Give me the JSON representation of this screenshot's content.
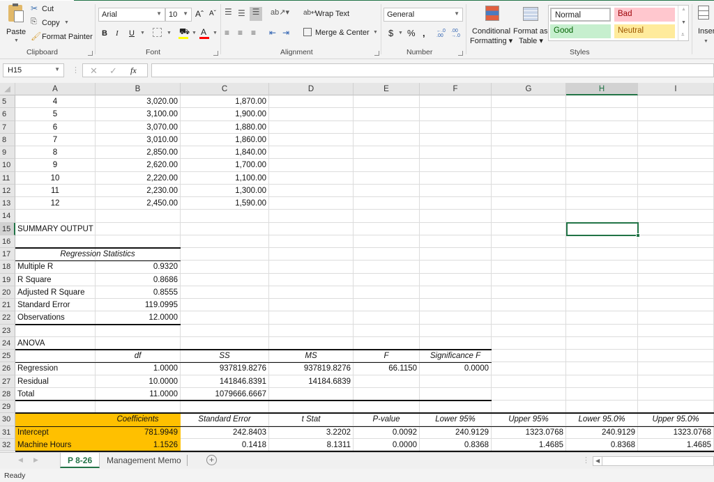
{
  "ribbon": {
    "clipboard": {
      "paste": "Paste",
      "cut": "Cut",
      "copy": "Copy",
      "format_painter": "Format Painter",
      "label": "Clipboard"
    },
    "font": {
      "name": "Arial",
      "size": "10",
      "bold": "B",
      "italic": "I",
      "underline": "U",
      "grow": "Aˆ",
      "shrink": "Aˇ",
      "label": "Font",
      "fill_color": "#ffff00",
      "font_color": "#ff0000"
    },
    "alignment": {
      "wrap_text": "Wrap Text",
      "merge_center": "Merge & Center",
      "label": "Alignment"
    },
    "number": {
      "format": "General",
      "currency": "$",
      "percent": "%",
      "comma": ",",
      "inc_decimal": "←.0 .00",
      "dec_decimal": ".00 →.0",
      "label": "Number"
    },
    "styles": {
      "conditional_formatting_1": "Conditional",
      "conditional_formatting_2": "Formatting",
      "format_as_table_1": "Format as",
      "format_as_table_2": "Table",
      "normal": "Normal",
      "bad": "Bad",
      "good": "Good",
      "neutral": "Neutral",
      "label": "Styles",
      "bad_bg": "#ffc7ce",
      "bad_fg": "#9c0006",
      "good_bg": "#c6efce",
      "good_fg": "#006100",
      "neutral_bg": "#ffeb9c",
      "neutral_fg": "#9c5700"
    },
    "cells": {
      "insert": "Insert"
    }
  },
  "formula_bar": {
    "name_box": "H15",
    "fx": "fx",
    "formula": ""
  },
  "columns": [
    "A",
    "B",
    "C",
    "D",
    "E",
    "F",
    "G",
    "H",
    "I"
  ],
  "selected_column": "H",
  "selected_row": "15",
  "rows": [
    "5",
    "6",
    "7",
    "8",
    "9",
    "10",
    "11",
    "12",
    "13",
    "14",
    "15",
    "16",
    "17",
    "18",
    "19",
    "20",
    "21",
    "22",
    "23",
    "24",
    "25",
    "26",
    "27",
    "28",
    "29",
    "30",
    "31",
    "32"
  ],
  "data_table": [
    {
      "month": "4",
      "cost": "3,020.00",
      "hours": "1,870.00"
    },
    {
      "month": "5",
      "cost": "3,100.00",
      "hours": "1,900.00"
    },
    {
      "month": "6",
      "cost": "3,070.00",
      "hours": "1,880.00"
    },
    {
      "month": "7",
      "cost": "3,010.00",
      "hours": "1,860.00"
    },
    {
      "month": "8",
      "cost": "2,850.00",
      "hours": "1,840.00"
    },
    {
      "month": "9",
      "cost": "2,620.00",
      "hours": "1,700.00"
    },
    {
      "month": "10",
      "cost": "2,220.00",
      "hours": "1,100.00"
    },
    {
      "month": "11",
      "cost": "2,230.00",
      "hours": "1,300.00"
    },
    {
      "month": "12",
      "cost": "2,450.00",
      "hours": "1,590.00"
    }
  ],
  "summary": {
    "title": "SUMMARY OUTPUT",
    "regression_statistics": {
      "header": "Regression Statistics",
      "rows": [
        {
          "label": "Multiple R",
          "value": "0.9320"
        },
        {
          "label": "R Square",
          "value": "0.8686"
        },
        {
          "label": "Adjusted R Square",
          "value": "0.8555"
        },
        {
          "label": "Standard Error",
          "value": "119.0995"
        },
        {
          "label": "Observations",
          "value": "12.0000"
        }
      ]
    },
    "anova": {
      "title": "ANOVA",
      "headers": [
        "df",
        "SS",
        "MS",
        "F",
        "Significance F"
      ],
      "rows": [
        {
          "label": "Regression",
          "df": "1.0000",
          "ss": "937819.8276",
          "ms": "937819.8276",
          "f": "66.1150",
          "sig": "0.0000"
        },
        {
          "label": "Residual",
          "df": "10.0000",
          "ss": "141846.8391",
          "ms": "14184.6839",
          "f": "",
          "sig": ""
        },
        {
          "label": "Total",
          "df": "11.0000",
          "ss": "1079666.6667",
          "ms": "",
          "f": "",
          "sig": ""
        }
      ]
    },
    "coefficients": {
      "headers": [
        "Coefficients",
        "Standard Error",
        "t Stat",
        "P-value",
        "Lower 95%",
        "Upper 95%",
        "Lower 95.0%",
        "Upper 95.0%"
      ],
      "rows": [
        {
          "label": "Intercept",
          "values": [
            "781.9949",
            "242.8403",
            "3.2202",
            "0.0092",
            "240.9129",
            "1323.0768",
            "240.9129",
            "1323.0768"
          ]
        },
        {
          "label": "Machine Hours",
          "values": [
            "1.1526",
            "0.1418",
            "8.1311",
            "0.0000",
            "0.8368",
            "1.4685",
            "0.8368",
            "1.4685"
          ]
        }
      ],
      "highlight_color": "#ffc000"
    }
  },
  "sheet_tabs": {
    "tabs": [
      "P 8-26",
      "Management Memo"
    ],
    "active": "P 8-26",
    "add": "+"
  },
  "status": {
    "text": "Ready"
  }
}
